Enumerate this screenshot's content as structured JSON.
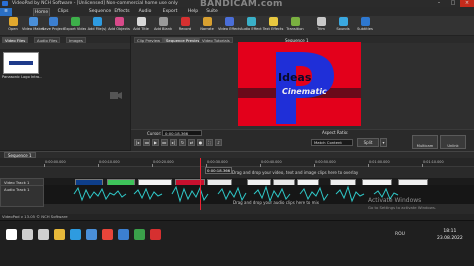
{
  "window": {
    "title": "VideoPad by NCH Software - [Unlicensed] Non-commercial home use only",
    "recording_watermark": "BANDICAM.com",
    "controls": [
      "–",
      "□",
      "×"
    ]
  },
  "menu": {
    "tabs": [
      {
        "label": "Home"
      },
      {
        "label": "Clips"
      },
      {
        "label": "Sequence"
      },
      {
        "label": "Effects"
      },
      {
        "label": "Audio"
      },
      {
        "label": "Export"
      },
      {
        "label": "Help"
      },
      {
        "label": "Suite"
      }
    ]
  },
  "ribbon": {
    "buttons": [
      {
        "label": "Open",
        "icon": "open-folder-icon",
        "color": "#e0a82e"
      },
      {
        "label": "Video Maker",
        "icon": "video-maker-icon",
        "color": "#4a8fd8"
      },
      {
        "label": "Save Project",
        "icon": "save-icon",
        "color": "#3c7fd0"
      },
      {
        "label": "Export Video",
        "icon": "export-video-icon",
        "color": "#3db04a"
      },
      {
        "label": "Add File(s)",
        "icon": "add-files-icon",
        "color": "#2e9be0"
      },
      {
        "label": "Add Objects",
        "icon": "add-objects-icon",
        "color": "#d84a8a"
      },
      {
        "label": "Add Title",
        "icon": "add-title-icon",
        "color": "#d8d8d8"
      },
      {
        "label": "Add Blank",
        "icon": "add-blank-icon",
        "color": "#9a9a9a"
      },
      {
        "label": "Record",
        "icon": "record-icon",
        "color": "#d63030"
      },
      {
        "label": "Narrate",
        "icon": "narrate-icon",
        "color": "#d8a030"
      },
      {
        "label": "Video Effects",
        "icon": "video-effects-icon",
        "color": "#4a6ed8"
      },
      {
        "label": "Audio Effects",
        "icon": "audio-effects-icon",
        "color": "#3ab0c8"
      },
      {
        "label": "Text Effects",
        "icon": "text-effects-icon",
        "color": "#e8c840"
      },
      {
        "label": "Transition",
        "icon": "transition-icon",
        "color": "#7ab040"
      },
      {
        "label": "Trim",
        "icon": "trim-icon",
        "color": "#c8c8c8"
      },
      {
        "label": "Sounds",
        "icon": "sounds-icon",
        "color": "#3aa8e0"
      },
      {
        "label": "Subtitles",
        "icon": "subtitles-icon",
        "color": "#2e78d0"
      }
    ]
  },
  "bins": {
    "tabs": [
      {
        "label": "Video Files"
      },
      {
        "label": "Audio Files"
      },
      {
        "label": "Images"
      }
    ],
    "items": [
      {
        "label": "Panasonic Logo Intro..."
      }
    ]
  },
  "preview": {
    "tabs": [
      {
        "label": "Clip Preview"
      },
      {
        "label": "Sequence Preview"
      },
      {
        "label": "Video Tutorials"
      }
    ],
    "sequence_label": "Sequence 1",
    "frame_text_top": "Ideas",
    "frame_text_bottom": "Cinematic"
  },
  "transport": {
    "current_label": "Cursor:",
    "current_time": "0:00:18.366",
    "aspect_label": "Aspect Ratio:",
    "aspect_value": "Match Content",
    "split_label": "Split",
    "multicam_label": "Multicam",
    "unlink_label": "Unlink"
  },
  "timeline": {
    "sequence_tab": "Sequence 1",
    "ruler_ticks": [
      "0:00:00.000",
      "0:00:10.000",
      "0:00:20.000",
      "0:00:30.000",
      "0:00:40.000",
      "0:00:50.000",
      "0:01:00.000",
      "0:01:10.000",
      "0:01:20.000"
    ],
    "playhead_time": "0:00:18.366",
    "video_track_label": "Video Track 1",
    "audio_track_label": "Audio Track 1",
    "drop_video_hint": "Drag and drop your video, text and image clips here to overlay",
    "drop_audio_hint": "Drag and drop your audio clips here to mix"
  },
  "watermark": {
    "title": "Activate Windows",
    "subtitle": "Go to Settings to activate Windows."
  },
  "status_bar": "VideoPad v 13.05 © NCH Software",
  "taskbar": {
    "icons": [
      {
        "name": "windows-start-icon",
        "color": "#ffffff"
      },
      {
        "name": "search-icon",
        "color": "#cfcfcf"
      },
      {
        "name": "task-view-icon",
        "color": "#cfcfcf"
      },
      {
        "name": "file-explorer-icon",
        "color": "#e8b93a"
      },
      {
        "name": "edge-browser-icon",
        "color": "#2e9be0"
      },
      {
        "name": "store-icon",
        "color": "#4a8fd8"
      },
      {
        "name": "chrome-icon",
        "color": "#e8453a"
      },
      {
        "name": "mail-icon",
        "color": "#3c7fd0"
      },
      {
        "name": "videopad-icon",
        "color": "#3aa04a"
      },
      {
        "name": "bandicam-icon",
        "color": "#d63030"
      }
    ],
    "tray_language": "ROU",
    "clock_time": "18:11",
    "clock_date": "23.08.2022"
  }
}
